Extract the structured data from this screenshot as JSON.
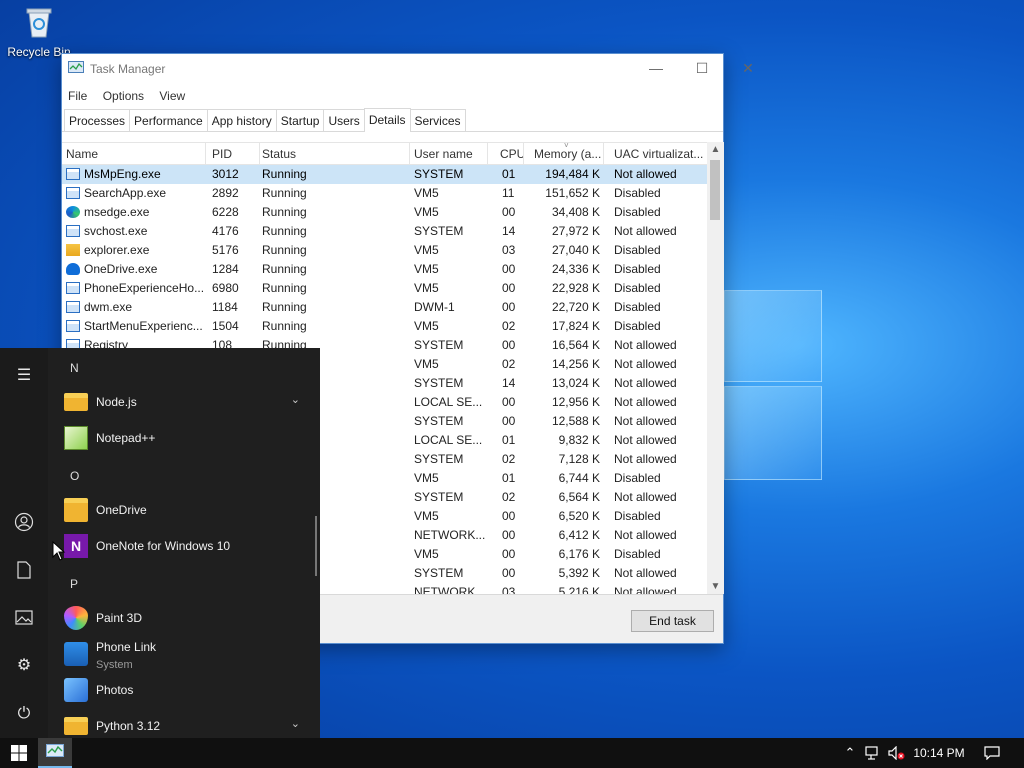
{
  "desktop": {
    "recycle_bin_label": "Recycle Bin"
  },
  "task_manager": {
    "title": "Task Manager",
    "menu": [
      "File",
      "Options",
      "View"
    ],
    "tabs": [
      "Processes",
      "Performance",
      "App history",
      "Startup",
      "Users",
      "Details",
      "Services"
    ],
    "active_tab": "Details",
    "columns": [
      "Name",
      "PID",
      "Status",
      "User name",
      "CPU",
      "Memory (a...",
      "UAC virtualizat..."
    ],
    "rows": [
      {
        "name": "MsMpEng.exe",
        "pid": "3012",
        "status": "Running",
        "user": "SYSTEM",
        "cpu": "01",
        "mem": "194,484 K",
        "uac": "Not allowed",
        "icon": "window"
      },
      {
        "name": "SearchApp.exe",
        "pid": "2892",
        "status": "Running",
        "user": "VM5",
        "cpu": "11",
        "mem": "151,652 K",
        "uac": "Disabled",
        "icon": "window"
      },
      {
        "name": "msedge.exe",
        "pid": "6228",
        "status": "Running",
        "user": "VM5",
        "cpu": "00",
        "mem": "34,408 K",
        "uac": "Disabled",
        "icon": "edge"
      },
      {
        "name": "svchost.exe",
        "pid": "4176",
        "status": "Running",
        "user": "SYSTEM",
        "cpu": "14",
        "mem": "27,972 K",
        "uac": "Not allowed",
        "icon": "window"
      },
      {
        "name": "explorer.exe",
        "pid": "5176",
        "status": "Running",
        "user": "VM5",
        "cpu": "03",
        "mem": "27,040 K",
        "uac": "Disabled",
        "icon": "folder"
      },
      {
        "name": "OneDrive.exe",
        "pid": "1284",
        "status": "Running",
        "user": "VM5",
        "cpu": "00",
        "mem": "24,336 K",
        "uac": "Disabled",
        "icon": "cloud"
      },
      {
        "name": "PhoneExperienceHo...",
        "pid": "6980",
        "status": "Running",
        "user": "VM5",
        "cpu": "00",
        "mem": "22,928 K",
        "uac": "Disabled",
        "icon": "window"
      },
      {
        "name": "dwm.exe",
        "pid": "1184",
        "status": "Running",
        "user": "DWM-1",
        "cpu": "00",
        "mem": "22,720 K",
        "uac": "Disabled",
        "icon": "window"
      },
      {
        "name": "StartMenuExperienc...",
        "pid": "1504",
        "status": "Running",
        "user": "VM5",
        "cpu": "02",
        "mem": "17,824 K",
        "uac": "Disabled",
        "icon": "window"
      },
      {
        "name": "Registry",
        "pid": "108",
        "status": "Running",
        "user": "SYSTEM",
        "cpu": "00",
        "mem": "16,564 K",
        "uac": "Not allowed",
        "icon": "window"
      },
      {
        "name": "",
        "pid": "",
        "status": "",
        "user": "VM5",
        "cpu": "02",
        "mem": "14,256 K",
        "uac": "Not allowed",
        "icon": ""
      },
      {
        "name": "",
        "pid": "",
        "status": "",
        "user": "SYSTEM",
        "cpu": "14",
        "mem": "13,024 K",
        "uac": "Not allowed",
        "icon": ""
      },
      {
        "name": "",
        "pid": "",
        "status": "",
        "user": "LOCAL SE...",
        "cpu": "00",
        "mem": "12,956 K",
        "uac": "Not allowed",
        "icon": ""
      },
      {
        "name": "",
        "pid": "",
        "status": "",
        "user": "SYSTEM",
        "cpu": "00",
        "mem": "12,588 K",
        "uac": "Not allowed",
        "icon": ""
      },
      {
        "name": "",
        "pid": "",
        "status": "",
        "user": "LOCAL SE...",
        "cpu": "01",
        "mem": "9,832 K",
        "uac": "Not allowed",
        "icon": ""
      },
      {
        "name": "",
        "pid": "",
        "status": "",
        "user": "SYSTEM",
        "cpu": "02",
        "mem": "7,128 K",
        "uac": "Not allowed",
        "icon": ""
      },
      {
        "name": "",
        "pid": "",
        "status": "",
        "user": "VM5",
        "cpu": "01",
        "mem": "6,744 K",
        "uac": "Disabled",
        "icon": ""
      },
      {
        "name": "",
        "pid": "",
        "status": "",
        "user": "SYSTEM",
        "cpu": "02",
        "mem": "6,564 K",
        "uac": "Not allowed",
        "icon": ""
      },
      {
        "name": "",
        "pid": "",
        "status": "",
        "user": "VM5",
        "cpu": "00",
        "mem": "6,520 K",
        "uac": "Disabled",
        "icon": ""
      },
      {
        "name": "",
        "pid": "",
        "status": "",
        "user": "NETWORK...",
        "cpu": "00",
        "mem": "6,412 K",
        "uac": "Not allowed",
        "icon": ""
      },
      {
        "name": "",
        "pid": "",
        "status": "",
        "user": "VM5",
        "cpu": "00",
        "mem": "6,176 K",
        "uac": "Disabled",
        "icon": ""
      },
      {
        "name": "",
        "pid": "",
        "status": "",
        "user": "SYSTEM",
        "cpu": "00",
        "mem": "5,392 K",
        "uac": "Not allowed",
        "icon": ""
      },
      {
        "name": "",
        "pid": "",
        "status": "",
        "user": "NETWORK...",
        "cpu": "03",
        "mem": "5,216 K",
        "uac": "Not allowed",
        "icon": ""
      }
    ],
    "end_task_label": "End task"
  },
  "start_menu": {
    "items": [
      {
        "type": "letter",
        "label": "N"
      },
      {
        "type": "app",
        "label": "Node.js",
        "icon": "folder-icon",
        "expandable": true
      },
      {
        "type": "app",
        "label": "Notepad++",
        "icon": "notepad-plus-plus-icon"
      },
      {
        "type": "letter",
        "label": "O"
      },
      {
        "type": "app",
        "label": "OneDrive",
        "icon": "onedrive-icon"
      },
      {
        "type": "app",
        "label": "OneNote for Windows 10",
        "icon": "onenote-icon"
      },
      {
        "type": "letter",
        "label": "P"
      },
      {
        "type": "app",
        "label": "Paint 3D",
        "icon": "paint-3d-icon"
      },
      {
        "type": "app",
        "label": "Phone Link",
        "sublabel": "System",
        "icon": "phone-link-icon"
      },
      {
        "type": "app",
        "label": "Photos",
        "icon": "photos-icon"
      },
      {
        "type": "app",
        "label": "Python 3.12",
        "icon": "folder-icon",
        "expandable": true
      }
    ],
    "rail": [
      "hamburger-menu-icon",
      "user-account-icon",
      "documents-icon",
      "pictures-icon",
      "settings-gear-icon",
      "power-icon"
    ]
  },
  "taskbar": {
    "clock": "10:14 PM"
  },
  "colors": {
    "accent": "#0078d7",
    "selection": "#cce4f7",
    "start_bg": "#1f1f1f",
    "taskbar_bg": "#101010"
  }
}
